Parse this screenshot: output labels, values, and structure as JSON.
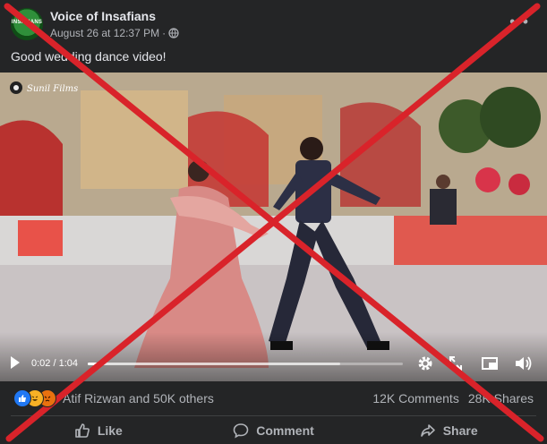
{
  "post": {
    "page_name": "Voice of Insafians",
    "avatar_text": "INSAFIANS",
    "timestamp": "August 26 at 12:37 PM",
    "separator": "·",
    "caption": "Good wedding dance video!"
  },
  "video": {
    "current_time": "0:02",
    "duration": "1:04",
    "time_separator": " / ",
    "progress_fraction": 0.03,
    "watermark": "Sunil Films"
  },
  "reactions": {
    "types": [
      "like-icon",
      "haha-icon",
      "angry-icon"
    ],
    "colors": {
      "like": "#2078f4",
      "haha": "#f7b125",
      "angry": "#e9710f"
    },
    "reactors_text": "Atif Rizwan and 50K others",
    "comments": "12K Comments",
    "shares": "28K Shares"
  },
  "actions": {
    "like": "Like",
    "comment": "Comment",
    "share": "Share"
  },
  "overlay": {
    "color": "#d9232a",
    "meaning": "false-content-x-mark"
  }
}
